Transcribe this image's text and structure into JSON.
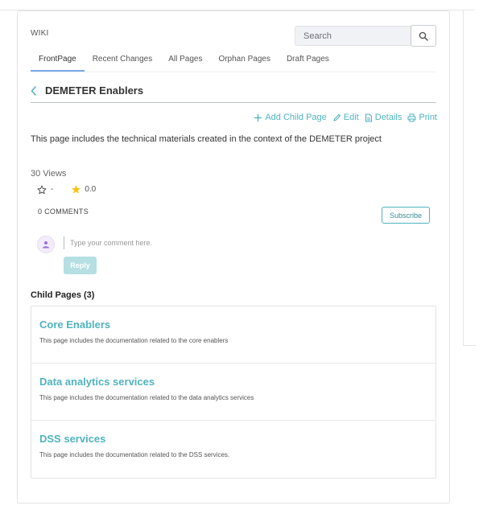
{
  "header": {
    "wiki_label": "WIKI",
    "search": {
      "placeholder": "Search",
      "icon": "search-icon"
    }
  },
  "tabs": [
    {
      "label": "FrontPage",
      "active": true
    },
    {
      "label": "Recent Changes",
      "active": false
    },
    {
      "label": "All Pages",
      "active": false
    },
    {
      "label": "Orphan Pages",
      "active": false
    },
    {
      "label": "Draft Pages",
      "active": false
    }
  ],
  "page": {
    "title": "DEMETER Enablers",
    "back_icon": "chevron-left-icon",
    "actions": [
      {
        "label": "Add Child Page",
        "icon": "plus-icon"
      },
      {
        "label": "Edit",
        "icon": "pencil-icon"
      },
      {
        "label": "Details",
        "icon": "document-icon"
      },
      {
        "label": "Print",
        "icon": "printer-icon"
      }
    ],
    "intro": "This page includes the technical materials created in the context of the DEMETER project",
    "views": "30 Views",
    "rating": {
      "user_rating": "-",
      "average_rating": "0.0"
    }
  },
  "comments": {
    "count_label": "0 COMMENTS",
    "subscribe_label": "Subscribe",
    "input_placeholder": "Type your comment here.",
    "reply_label": "Reply"
  },
  "child_pages": {
    "heading": "Child Pages (3)",
    "items": [
      {
        "title": "Core Enablers",
        "description": "This page includes the documentation related to the core enablers"
      },
      {
        "title": "Data analytics services",
        "description": "This page includes the documentation related to the data analytics services"
      },
      {
        "title": "DSS services",
        "description": "This page includes the documentation related to the DSS services."
      }
    ]
  },
  "colors": {
    "accent": "#4fb3be",
    "tab_underline": "#7aa9e8",
    "star_filled": "#f5c518",
    "reply_bg": "#b5dfe3"
  }
}
